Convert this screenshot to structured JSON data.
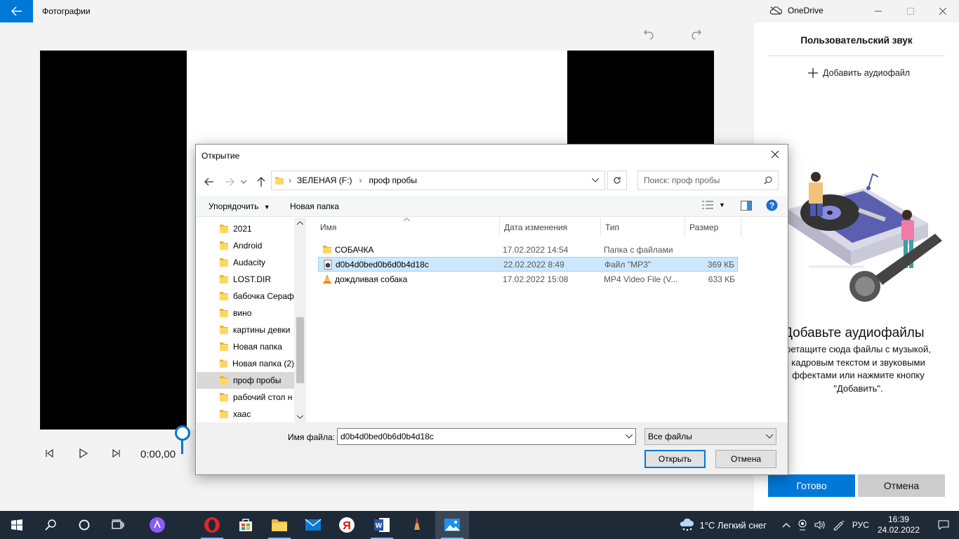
{
  "app": {
    "title": "Фотографии",
    "onedrive_label": "OneDrive"
  },
  "player": {
    "time": "0:00,00"
  },
  "right_pane": {
    "title": "Пользовательский звук",
    "add_audio_label": "Добавить аудиофайл",
    "heading": "Добавьте аудиофайлы",
    "desc_line1": "ретащите сюда файлы с музыкой,",
    "desc_line2": "кадровым текстом и звуковыми",
    "desc_line3": "ффектами или нажмите кнопку",
    "desc_line4": "\"Добавить\".",
    "done_label": "Готово",
    "cancel_label": "Отмена"
  },
  "dialog": {
    "title": "Открытие",
    "breadcrumb": [
      "ЗЕЛЕНАЯ (F:)",
      "проф пробы"
    ],
    "search_placeholder": "Поиск: проф пробы",
    "organize_label": "Упорядочить",
    "new_folder_label": "Новая папка",
    "tree": [
      {
        "label": "2021",
        "selected": false
      },
      {
        "label": "Android",
        "selected": false
      },
      {
        "label": "Audacity",
        "selected": false
      },
      {
        "label": "LOST.DIR",
        "selected": false
      },
      {
        "label": "бабочка Сераф",
        "selected": false
      },
      {
        "label": "вино",
        "selected": false
      },
      {
        "label": "картины девки",
        "selected": false
      },
      {
        "label": "Новая папка",
        "selected": false
      },
      {
        "label": "Новая папка (2)",
        "selected": false
      },
      {
        "label": "проф пробы",
        "selected": true
      },
      {
        "label": "рабочий стол н",
        "selected": false
      },
      {
        "label": "хаас",
        "selected": false
      }
    ],
    "columns": {
      "name": "Имя",
      "date": "Дата изменения",
      "type": "Тип",
      "size": "Размер"
    },
    "files": [
      {
        "name": "СОБАЧКА",
        "date": "17.02.2022 14:54",
        "type": "Папка с файлами",
        "size": "",
        "icon": "folder-icon",
        "selected": false
      },
      {
        "name": "d0b4d0bed0b6d0b4d18c",
        "date": "22.02.2022 8:49",
        "type": "Файл \"MP3\"",
        "size": "369 КБ",
        "icon": "mp3-file-icon",
        "selected": true
      },
      {
        "name": "дождливая собака",
        "date": "17.02.2022 15:08",
        "type": "MP4 Video File (V...",
        "size": "633 КБ",
        "icon": "vlc-file-icon",
        "selected": false
      }
    ],
    "filename_label": "Имя файла:",
    "filename_value": "d0b4d0bed0b6d0b4d18c",
    "filetype_value": "Все файлы",
    "open_label": "Открыть",
    "cancel_label": "Отмена"
  },
  "taskbar": {
    "weather": "1°C  Легкий снег",
    "language": "РУС",
    "time": "16:39",
    "date": "24.02.2022"
  },
  "colors": {
    "accent": "#0078d7",
    "selection": "#cce8ff",
    "taskbar": "#1f2a38"
  }
}
